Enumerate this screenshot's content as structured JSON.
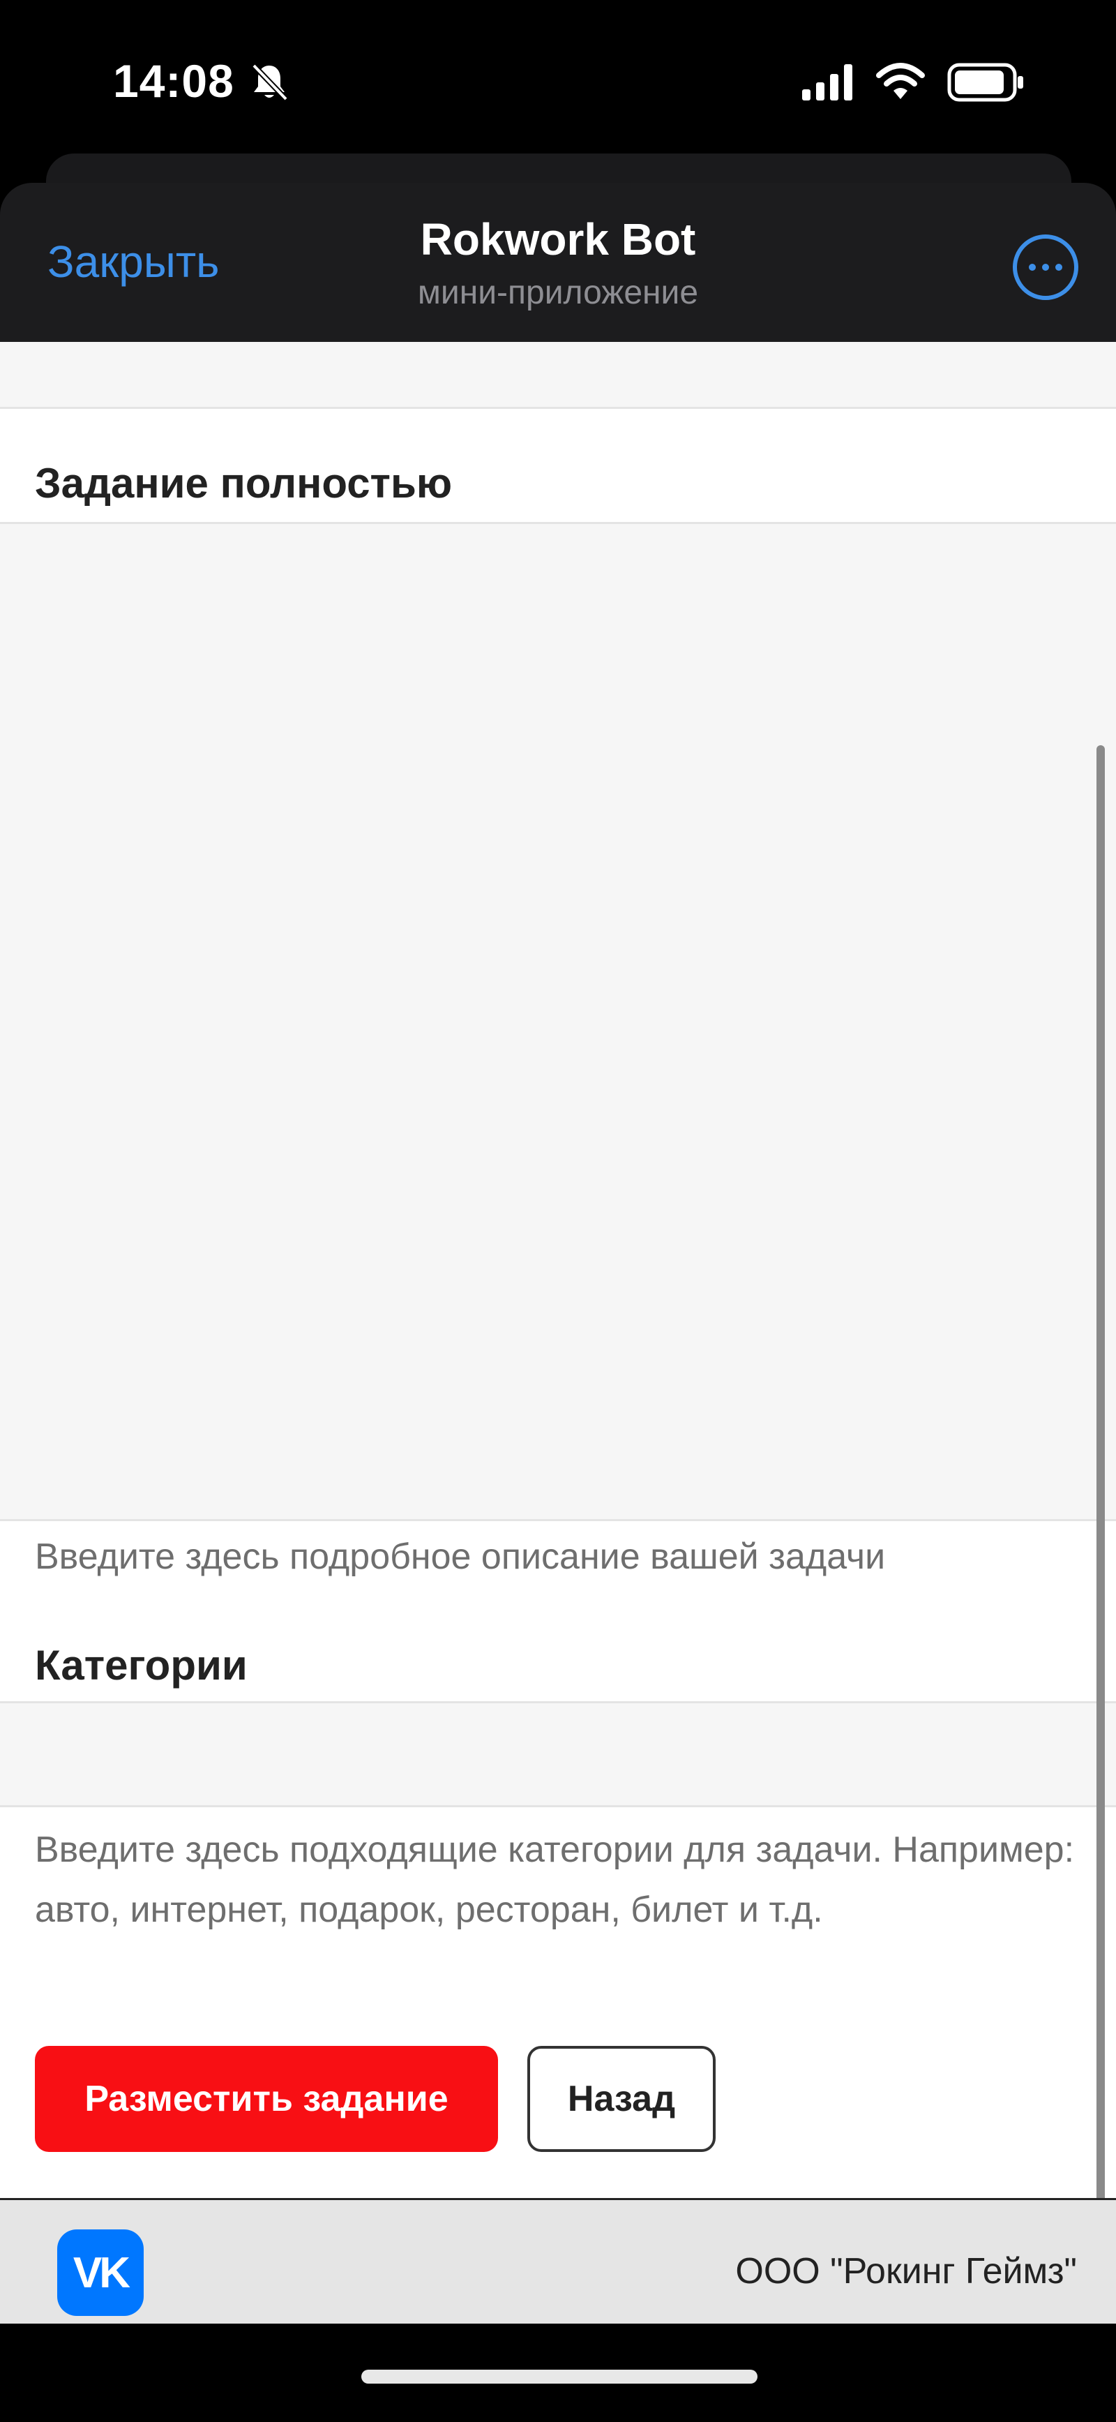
{
  "status_bar": {
    "time": "14:08",
    "icons": [
      "bell-off-icon",
      "signal-icon",
      "wifi-icon",
      "battery-icon"
    ]
  },
  "header": {
    "close_label": "Закрыть",
    "title": "Rokwork Bot",
    "subtitle": "мини-приложение",
    "more_icon": "more-icon"
  },
  "form": {
    "task_label": "Задание полностью",
    "task_value": "",
    "task_hint": "Введите здесь подробное описание вашей задачи",
    "categories_label": "Категории",
    "categories_value": "",
    "categories_hint": "Введите здесь подходящие категории для задачи. Например: авто, интернет, подарок, ресторан, билет и т.д.",
    "submit_label": "Разместить задание",
    "back_label": "Назад"
  },
  "footer": {
    "logo_text": "VK",
    "company": "ООО \"Рокинг Геймз\""
  },
  "colors": {
    "accent": "#3d8fe8",
    "primary_button": "#f80f14",
    "header_bg": "#1c1c1e",
    "vk_blue": "#0077ff"
  }
}
